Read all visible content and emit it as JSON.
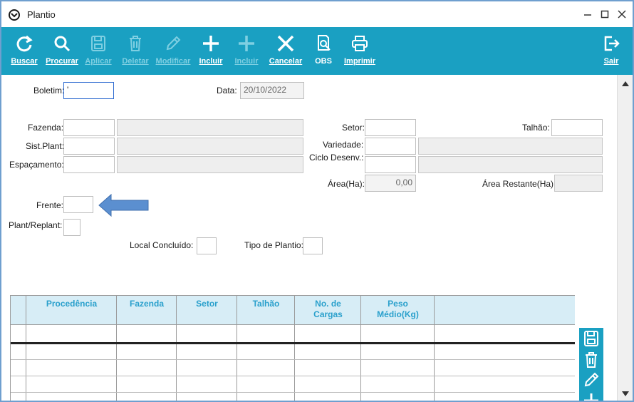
{
  "window": {
    "title": "Plantio"
  },
  "toolbar": {
    "buscar": "Buscar",
    "procurar": "Procurar",
    "aplicar": "Aplicar",
    "deletar": "Deletar",
    "modificar": "Modificar",
    "incluir": "Incluir",
    "incluir2": "Incluir",
    "cancelar": "Cancelar",
    "obs": "OBS",
    "imprimir": "Imprimir",
    "sair": "Sair"
  },
  "form": {
    "boletim_label": "Boletim:",
    "boletim_value": "'",
    "data_label": "Data:",
    "data_value": "20/10/2022",
    "fazenda_label": "Fazenda:",
    "sistplant_label": "Sist.Plant:",
    "espacamento_label": "Espaçamento:",
    "setor_label": "Setor:",
    "talhao_label": "Talhão:",
    "variedade_label": "Variedade:",
    "ciclo_label": "Ciclo Desenv.:",
    "area_label": "Área(Ha):",
    "area_value": "0,00",
    "area_restante_label": "Área Restante(Ha):",
    "frente_label": "Frente:",
    "plant_replant_label": "Plant/Replant:",
    "local_concluido_label": "Local Concluído:",
    "tipo_plantio_label": "Tipo de Plantio:"
  },
  "grid": {
    "columns": [
      "Procedência",
      "Fazenda",
      "Setor",
      "Talhão",
      "No. de\nCargas",
      "Peso\nMédio(Kg)"
    ]
  },
  "colors": {
    "toolbar": "#1aa0c2",
    "grid_header": "#d7edf6",
    "grid_header_text": "#2aa0cc",
    "arrow": "#5b8fd0"
  }
}
